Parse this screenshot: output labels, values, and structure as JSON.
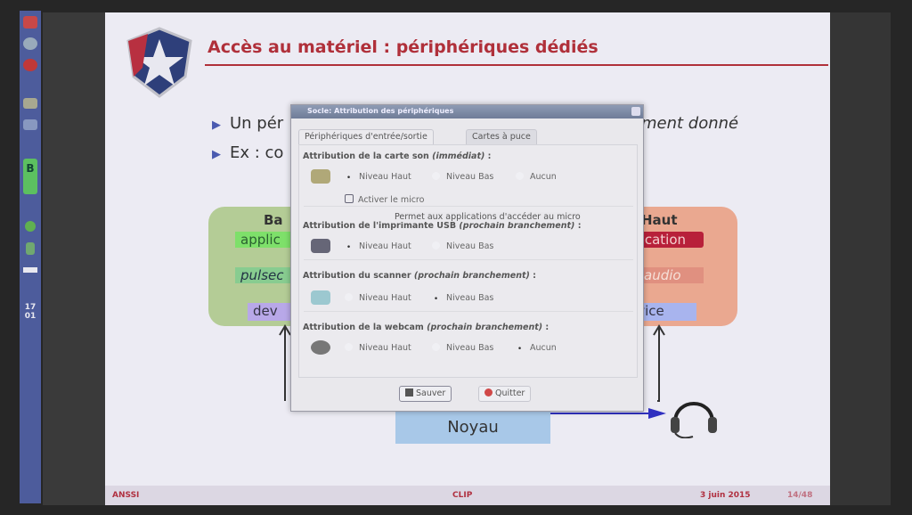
{
  "taskbar": {
    "clock_hour": "17",
    "clock_min": "01",
    "badge": "B"
  },
  "slide": {
    "title": "Accès au matériel : périphériques dédiés",
    "bullets": [
      {
        "left": "Un pér",
        "right": "ment donné"
      },
      {
        "left": "Ex : co"
      }
    ],
    "diagram": {
      "low": {
        "heading": "Ba",
        "app": "applic",
        "pulse": "pulsec",
        "device": "dev"
      },
      "high": {
        "heading": "Haut",
        "app": "plication",
        "pulse": "seaudio",
        "device": "evice"
      },
      "kernel": "Noyau"
    },
    "footer": {
      "org": "ANSSI",
      "project": "CLIP",
      "date": "3 juin 2015",
      "page": "14/48"
    }
  },
  "dialog": {
    "title": "Socle: Attribution des périphériques",
    "tabs": [
      {
        "label": "Périphériques d'entrée/sortie",
        "active": true
      },
      {
        "label": "Cartes à puce",
        "active": false
      }
    ],
    "sections": [
      {
        "heading": "Attribution de la carte son",
        "qualifier": "(immédiat)",
        "suffix": " :",
        "icon": "sound-card-icon",
        "options": [
          "Niveau Haut",
          "Niveau Bas",
          "Aucun"
        ],
        "selected": "Niveau Haut"
      },
      {
        "heading": "Attribution de l'imprimante USB",
        "qualifier": "(prochain branchement)",
        "suffix": " :",
        "icon": "printer-icon",
        "options": [
          "Niveau Haut",
          "Niveau Bas"
        ],
        "selected": "Niveau Haut"
      },
      {
        "heading": "Attribution du scanner",
        "qualifier": "(prochain branchement)",
        "suffix": " :",
        "icon": "scanner-icon",
        "options": [
          "Niveau Haut",
          "Niveau Bas"
        ],
        "selected": "Niveau Bas"
      },
      {
        "heading": "Attribution de la webcam",
        "qualifier": "(prochain branchement)",
        "suffix": " :",
        "icon": "webcam-icon",
        "options": [
          "Niveau Haut",
          "Niveau Bas",
          "Aucun"
        ],
        "selected": "Aucun"
      }
    ],
    "micro_checkbox": {
      "label": "Activer le micro",
      "checked": false
    },
    "tooltip": "Permet aux applications d'accéder au micro",
    "save": "Sauver",
    "quit": "Quitter"
  }
}
